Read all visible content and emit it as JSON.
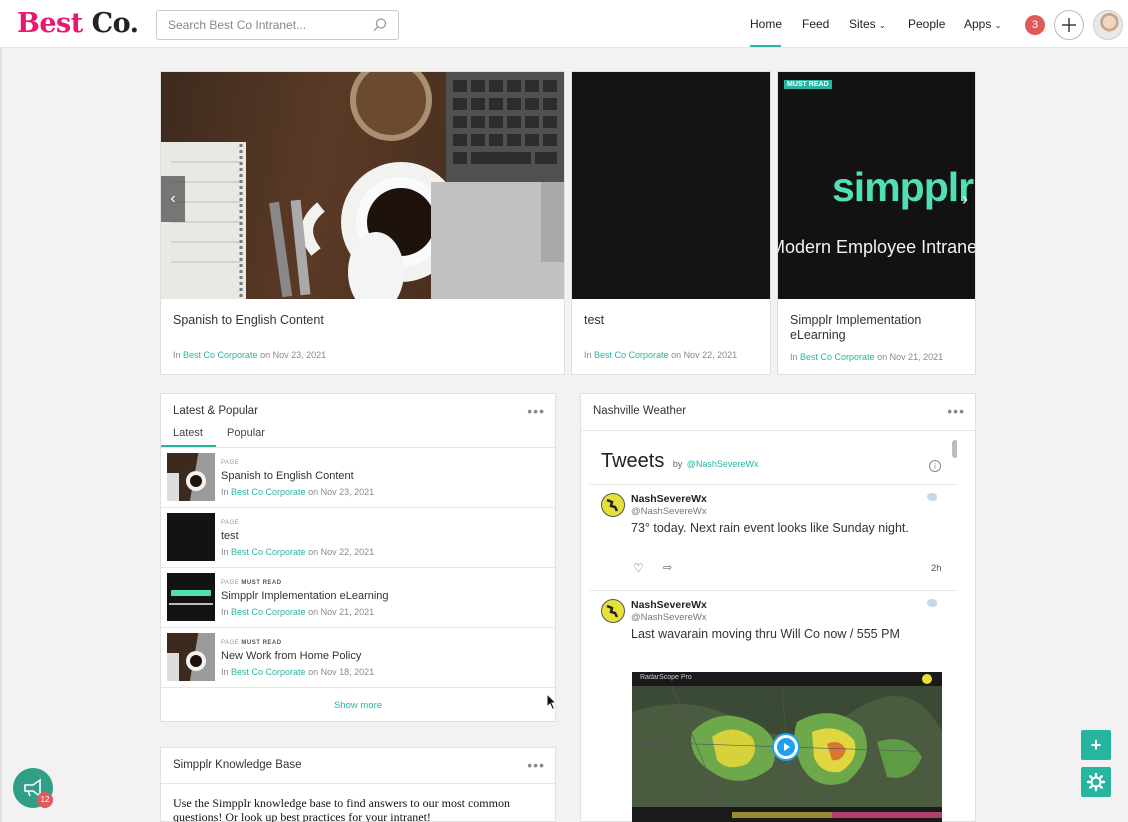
{
  "header": {
    "logo_part1": "Best",
    "logo_part2": "Co.",
    "search_placeholder": "Search Best Co Intranet...",
    "nav": [
      "Home",
      "Feed",
      "Sites",
      "People",
      "Apps"
    ],
    "notification_count": "3"
  },
  "carousel": [
    {
      "title": "Spanish to English Content",
      "in": "In",
      "site": "Best Co Corporate",
      "date": "on Nov 23, 2021"
    },
    {
      "title": "test",
      "in": "In",
      "site": "Best Co Corporate",
      "date": "on Nov 22, 2021"
    },
    {
      "badge": "MUST READ",
      "image_text1": "simpplr",
      "image_text2": "The Modern Employee Intranet",
      "title": "Simpplr Implementation eLearning",
      "in": "In",
      "site": "Best Co Corporate",
      "date": "on Nov 21, 2021"
    }
  ],
  "latest_popular": {
    "title": "Latest & Popular",
    "tabs": [
      "Latest",
      "Popular"
    ],
    "items": [
      {
        "type": "PAGE",
        "must": "",
        "title": "Spanish to English Content",
        "in": "In",
        "site": "Best Co Corporate",
        "date": "on Nov 23, 2021"
      },
      {
        "type": "PAGE",
        "must": "",
        "title": "test",
        "in": "In",
        "site": "Best Co Corporate",
        "date": "on Nov 22, 2021"
      },
      {
        "type": "PAGE",
        "must": "MUST READ",
        "title": "Simpplr Implementation eLearning",
        "in": "In",
        "site": "Best Co Corporate",
        "date": "on Nov 21, 2021"
      },
      {
        "type": "PAGE",
        "must": "MUST READ",
        "title": "New Work from Home Policy",
        "in": "In",
        "site": "Best Co Corporate",
        "date": "on Nov 18, 2021"
      }
    ],
    "show_more": "Show more"
  },
  "weather": {
    "title": "Nashville Weather",
    "tweets_heading": "Tweets",
    "by": "by",
    "by_handle": "@NashSevereWx",
    "tweets": [
      {
        "name": "NashSevereWx",
        "handle": "@NashSevereWx",
        "text": "73° today. Next rain event looks like Sunday night.",
        "time": "2h"
      },
      {
        "name": "NashSevereWx",
        "handle": "@NashSevereWx",
        "text": "Last wavarain moving thru Will Co now / 555 PM"
      }
    ],
    "radar_label": "RadarScope Pro"
  },
  "knowledge_base": {
    "title": "Simpplr Knowledge Base",
    "text": "Use the Simpplr knowledge base to find answers to our most common questions! Or look up best practices for your intranet!"
  },
  "feedback_count": "12"
}
